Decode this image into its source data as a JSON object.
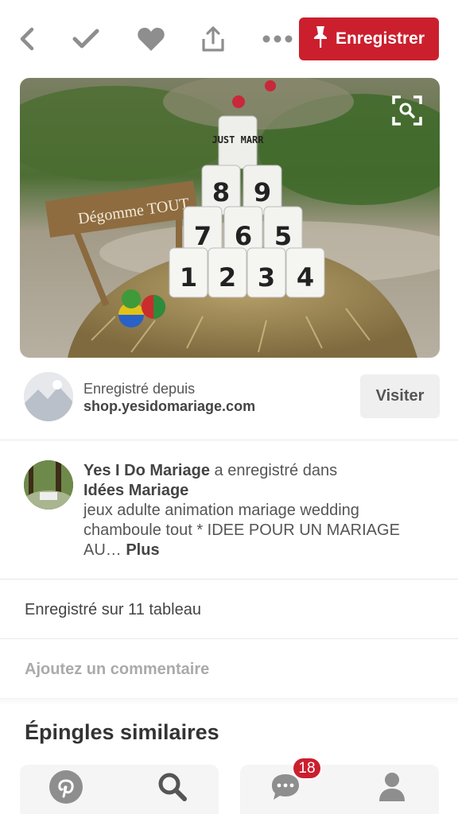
{
  "toolbar": {
    "save_label": "Enregistrer",
    "icons": [
      "back-icon",
      "check-icon",
      "heart-icon",
      "share-icon",
      "more-icon",
      "pin-icon"
    ]
  },
  "pin": {
    "sign_text": "Dégomme TOUT",
    "can_top_text": "JUST MARR",
    "can_numbers": [
      "8",
      "9",
      "7",
      "6",
      "5",
      "1",
      "2",
      "3",
      "4"
    ]
  },
  "source": {
    "label": "Enregistré depuis",
    "domain": "shop.yesidomariage.com",
    "visit_label": "Visiter"
  },
  "saver": {
    "name": "Yes I Do Mariage",
    "action": " a enregistré dans",
    "board": "Idées Mariage",
    "description": "jeux adulte animation mariage wedding chamboule tout * IDEE POUR UN MARIAGE AU… ",
    "more_label": "Plus"
  },
  "saved_count_text": "Enregistré sur 11 tableau",
  "comment_placeholder": "Ajoutez un commentaire",
  "similar_title": "Épingles similaires",
  "nav": {
    "notifications_badge": "18",
    "icons": [
      "pinterest-icon",
      "search-icon",
      "messages-icon",
      "profile-icon"
    ]
  },
  "colors": {
    "accent": "#cb1f2e",
    "icon_gray": "#8e8e8e"
  }
}
